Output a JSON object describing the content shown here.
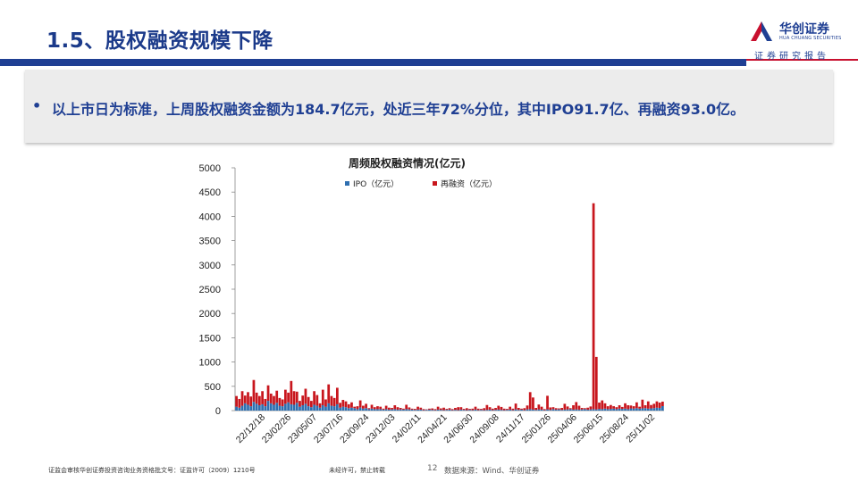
{
  "header": {
    "title": "1.5、股权融资规模下降",
    "logo_cn": "华创证券",
    "logo_en": "HUA CHUANG SECURITIES",
    "report_tag": "证券研究报告"
  },
  "summary": {
    "bullet": "•",
    "text": "以上市日为标准，上周股权融资金额为184.7亿元，处近三年72%分位，其中IPO91.7亿、再融资93.0亿。"
  },
  "colors": {
    "ipo": "#2e6fb0",
    "refinance": "#c8161d",
    "brand": "#1f3f93",
    "accent": "#c8102e"
  },
  "chart_data": {
    "type": "bar",
    "stacked": true,
    "title": "周频股权融资情况(亿元)",
    "ylim": [
      0,
      5000
    ],
    "yticks": [
      "5000",
      "4500",
      "4000",
      "3500",
      "3000",
      "2500",
      "2000",
      "1500",
      "1000",
      "500",
      "0"
    ],
    "xticks": [
      "22/12/18",
      "23/02/26",
      "23/05/07",
      "23/07/16",
      "23/09/24",
      "23/12/03",
      "24/02/11",
      "24/04/21",
      "24/06/30",
      "24/09/08",
      "24/11/17",
      "25/01/26",
      "25/04/06",
      "25/06/15",
      "25/08/24",
      "25/11/02"
    ],
    "legend": "top-left",
    "grid": false,
    "series": [
      {
        "name": "IPO（亿元）",
        "values": [
          80,
          60,
          100,
          150,
          120,
          90,
          180,
          140,
          110,
          130,
          90,
          200,
          150,
          120,
          160,
          100,
          90,
          140,
          170,
          130,
          120,
          160,
          80,
          110,
          140,
          90,
          70,
          120,
          100,
          60,
          110,
          80,
          150,
          100,
          90,
          130,
          60,
          80,
          70,
          50,
          60,
          50,
          30,
          60,
          40,
          50,
          30,
          40,
          30,
          30,
          30,
          20,
          30,
          20,
          25,
          30,
          20,
          25,
          20,
          30,
          25,
          20,
          15,
          20,
          20,
          10,
          15,
          20,
          15,
          10,
          20,
          15,
          10,
          15,
          20,
          10,
          15,
          10,
          20,
          15,
          10,
          15,
          10,
          20,
          10,
          15,
          10,
          15,
          20,
          10,
          15,
          20,
          15,
          10,
          15,
          20,
          10,
          25,
          15,
          20,
          10,
          25,
          30,
          20,
          15,
          25,
          20,
          10,
          25,
          15,
          30,
          20,
          25,
          15,
          20,
          25,
          30,
          20,
          25,
          20,
          25,
          30,
          20,
          25,
          30,
          25,
          35,
          30,
          40,
          30,
          35,
          40,
          30,
          40,
          35,
          40,
          30,
          45,
          40,
          50,
          40,
          45,
          50,
          40,
          45,
          50,
          60,
          55,
          92
        ]
      },
      {
        "name": "再融资（亿元）",
        "values": [
          220,
          180,
          300,
          160,
          260,
          200,
          450,
          230,
          190,
          270,
          150,
          320,
          200,
          180,
          250,
          160,
          140,
          290,
          200,
          480,
          280,
          230,
          120,
          200,
          310,
          190,
          130,
          280,
          220,
          90,
          320,
          150,
          390,
          200,
          170,
          340,
          100,
          140,
          120,
          80,
          110,
          30,
          60,
          150,
          60,
          90,
          20,
          80,
          40,
          60,
          50,
          20,
          70,
          40,
          30,
          80,
          50,
          30,
          20,
          90,
          40,
          20,
          20,
          60,
          40,
          20,
          10,
          20,
          30,
          20,
          60,
          30,
          50,
          20,
          30,
          20,
          40,
          60,
          50,
          20,
          40,
          20,
          30,
          60,
          30,
          20,
          40,
          100,
          50,
          30,
          40,
          80,
          60,
          30,
          20,
          60,
          30,
          120,
          40,
          20,
          40,
          80,
          350,
          250,
          40,
          100,
          60,
          20,
          280,
          50,
          40,
          30,
          20,
          40,
          120,
          60,
          20,
          90,
          150,
          80,
          30,
          20,
          40,
          60,
          4240,
          1080,
          130,
          180,
          110,
          60,
          80,
          50,
          40,
          70,
          40,
          110,
          80,
          60,
          50,
          120,
          40,
          180,
          60,
          150,
          70,
          90,
          130,
          110,
          93
        ]
      }
    ]
  },
  "footer": {
    "license": "证监会审核华创证券投资咨询业务资格批文号：证监许可（2009）1210号",
    "notice": "未经许可，禁止转载",
    "page": "12",
    "source": "数据来源：Wind、华创证券"
  }
}
